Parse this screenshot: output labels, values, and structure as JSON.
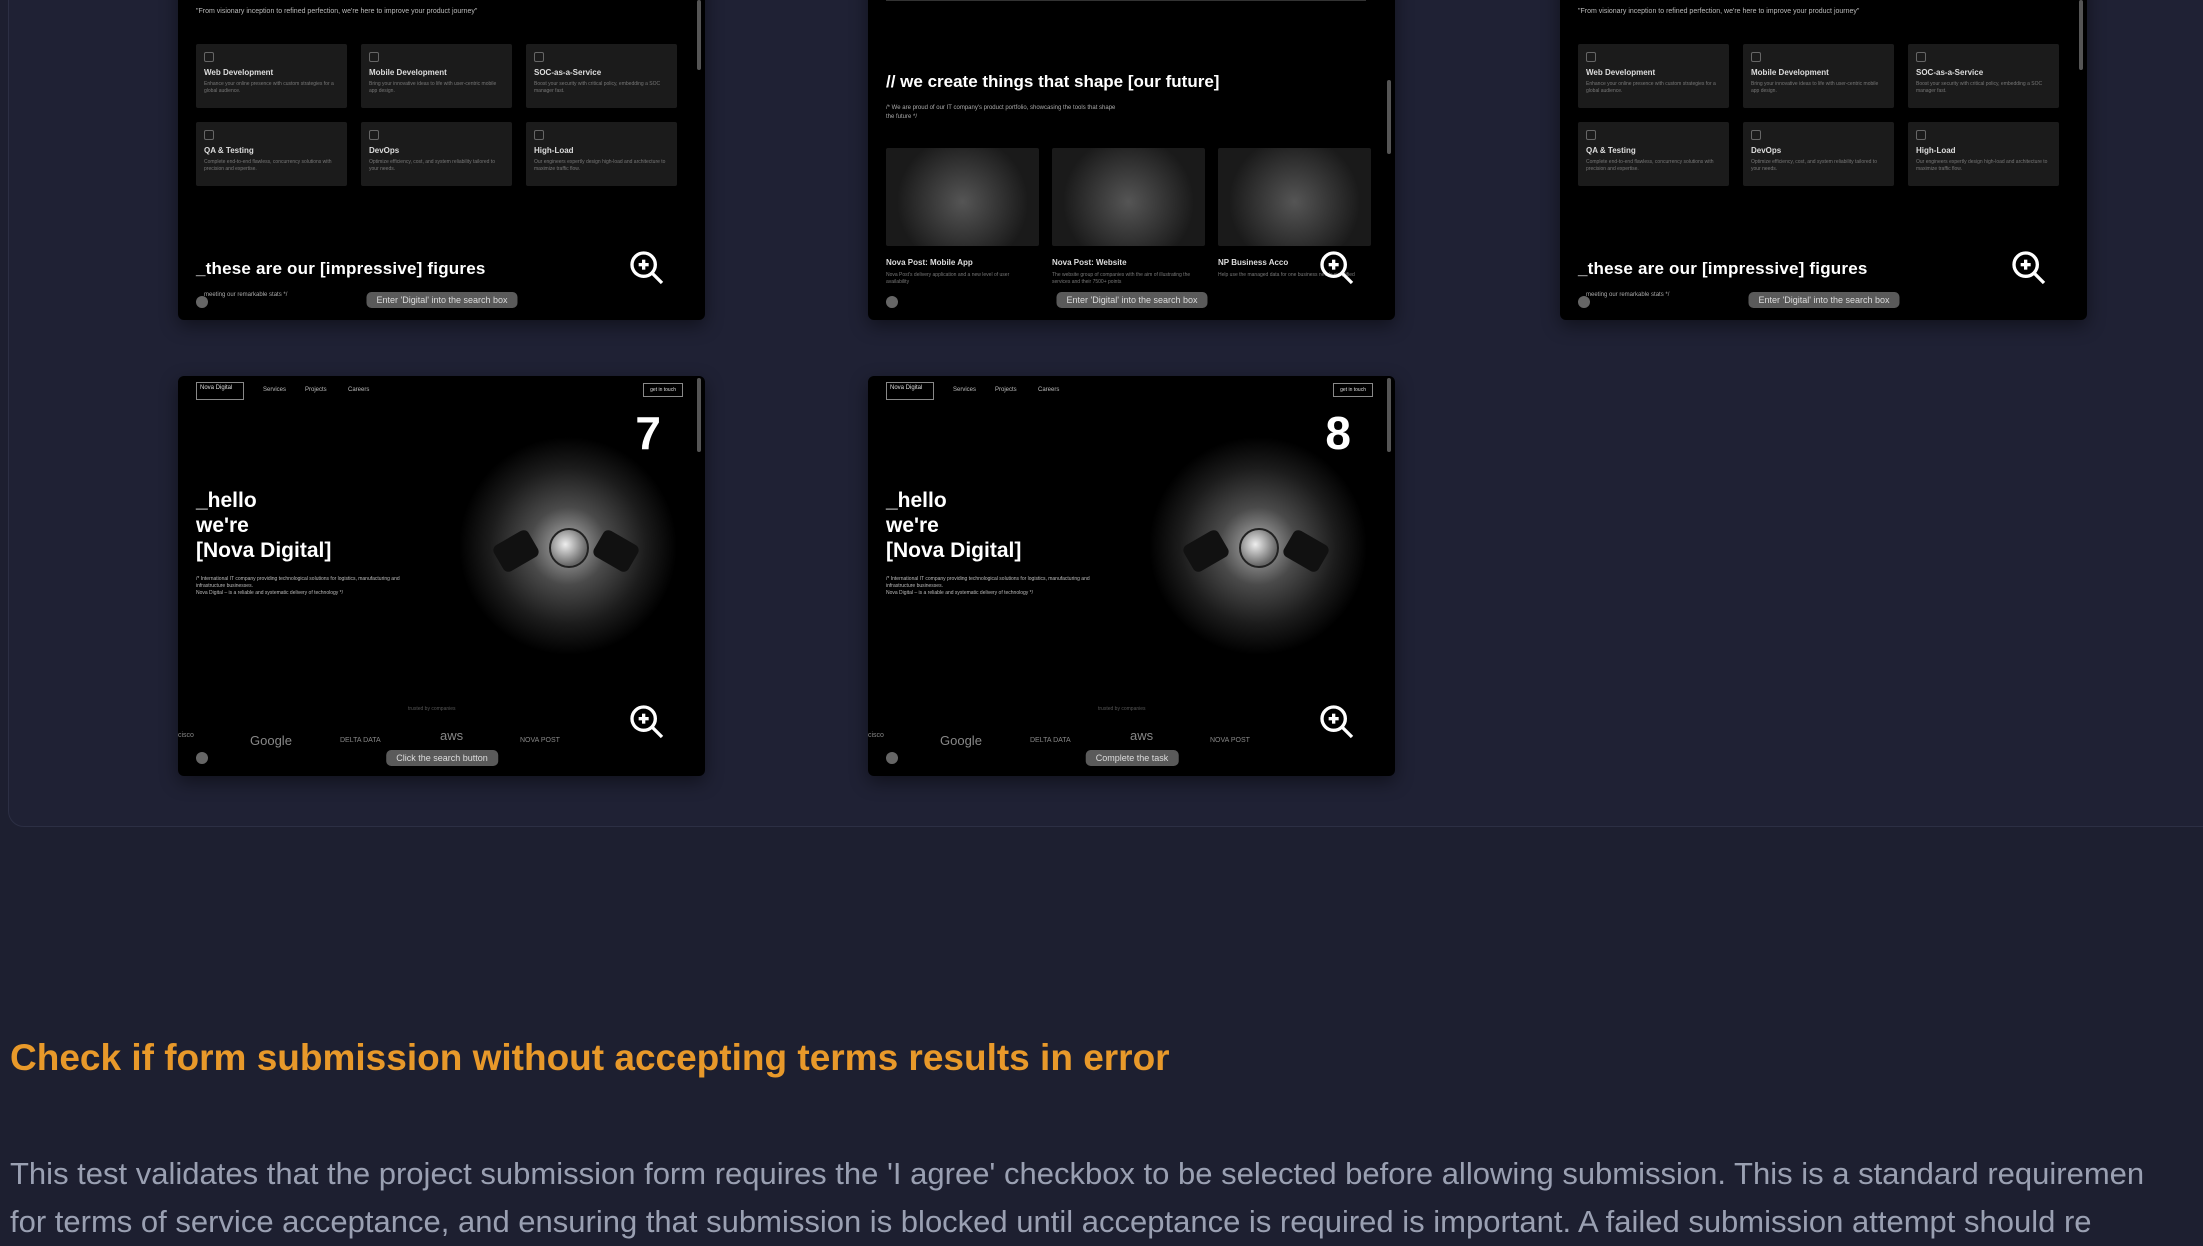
{
  "services_card": {
    "intro": "\"From visionary inception to refined perfection, we're here to improve your product journey\"",
    "services": [
      {
        "title": "Web Development",
        "desc": "Enhance your online presence with custom strategies for a global audience."
      },
      {
        "title": "Mobile Development",
        "desc": "Bring your innovative ideas to life with user-centric mobile app design."
      },
      {
        "title": "SOC-as-a-Service",
        "desc": "Boost your security with critical policy, embedding a SOC manager fast."
      },
      {
        "title": "QA & Testing",
        "desc": "Complete end-to-end flawless, concurrency solutions with precision and expertise."
      },
      {
        "title": "DevOps",
        "desc": "Optimize efficiency, cost, and system reliability tailored to your needs."
      },
      {
        "title": "High-Load",
        "desc": "Our engineers expertly design high-load and architecture to maximize traffic flow."
      }
    ],
    "figures_heading": "_these are our [impressive] figures",
    "figures_sub": "meeting our remarkable stats */",
    "tooltip": "Enter 'Digital' into the search box"
  },
  "projects_card": {
    "title": "// we create things that shape [our future]",
    "desc": "/* We are proud of our IT company's product portfolio, showcasing the tools that shape the future */",
    "projects": [
      {
        "label": "Nova Post: Mobile App",
        "desc": "Nova Post's delivery application and a new level of user availability"
      },
      {
        "label": "Nova Post: Website",
        "desc": "The website group of companies with the aim of illustrating the services and their 7500+ points"
      },
      {
        "label": "NP Business Acco",
        "desc": "Help use the managed data for one business needs simplified"
      }
    ],
    "tooltip": "Enter 'Digital' into the search box"
  },
  "hero_cards": [
    {
      "number": "7",
      "tooltip": "Click the search button"
    },
    {
      "number": "8",
      "tooltip": "Complete the task"
    }
  ],
  "hero": {
    "logo": "Nova Digital",
    "nav": [
      "Services",
      "Projects",
      "Careers"
    ],
    "cta": "get in touch",
    "line1": "_hello",
    "line2": "we're",
    "line3": "[Nova Digital]",
    "sub1": "/* International IT company providing technological solutions for logistics, manufacturing and infrastructure businesses.",
    "sub2": "Nova Digital – is a reliable and systematic delivery of technology */",
    "logos_caption": "trusted by companies",
    "logos": [
      "Google",
      "aws"
    ],
    "logos_small": [
      "DELTA DATA",
      "NOVA POST"
    ],
    "cisco": "cisco"
  },
  "section": {
    "heading": "Check if form submission without accepting terms results in error",
    "para1": "This test validates that the project submission form requires the 'I agree' checkbox to be selected before allowing submission. This is a standard requiremen",
    "para2": "for terms of service acceptance, and ensuring that submission is blocked until acceptance is required is important. A failed submission attempt should re"
  }
}
